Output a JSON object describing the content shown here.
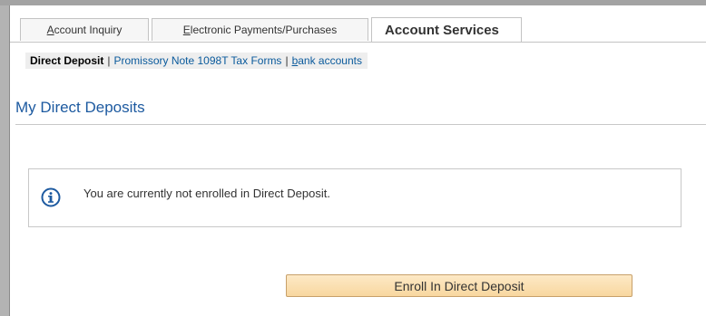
{
  "tabs": [
    {
      "accel": "A",
      "rest": "ccount Inquiry"
    },
    {
      "accel": "E",
      "rest": "lectronic Payments/Purchases"
    },
    {
      "label": "Account Services"
    }
  ],
  "subnav": {
    "current": "Direct Deposit",
    "separator": "|",
    "link1": "Promissory Note 1098T Tax Forms",
    "link2_accel": "b",
    "link2_rest": "ank accounts"
  },
  "page": {
    "title": "My Direct Deposits"
  },
  "message": {
    "icon": "info-icon",
    "text": "You are currently not enrolled in Direct Deposit."
  },
  "enroll_button": {
    "label": "Enroll In Direct Deposit"
  },
  "colors": {
    "title_blue": "#1d5aa0",
    "link_blue": "#0a5a9c",
    "button_fill": "#f8d79f",
    "button_border": "#c7a06a"
  }
}
